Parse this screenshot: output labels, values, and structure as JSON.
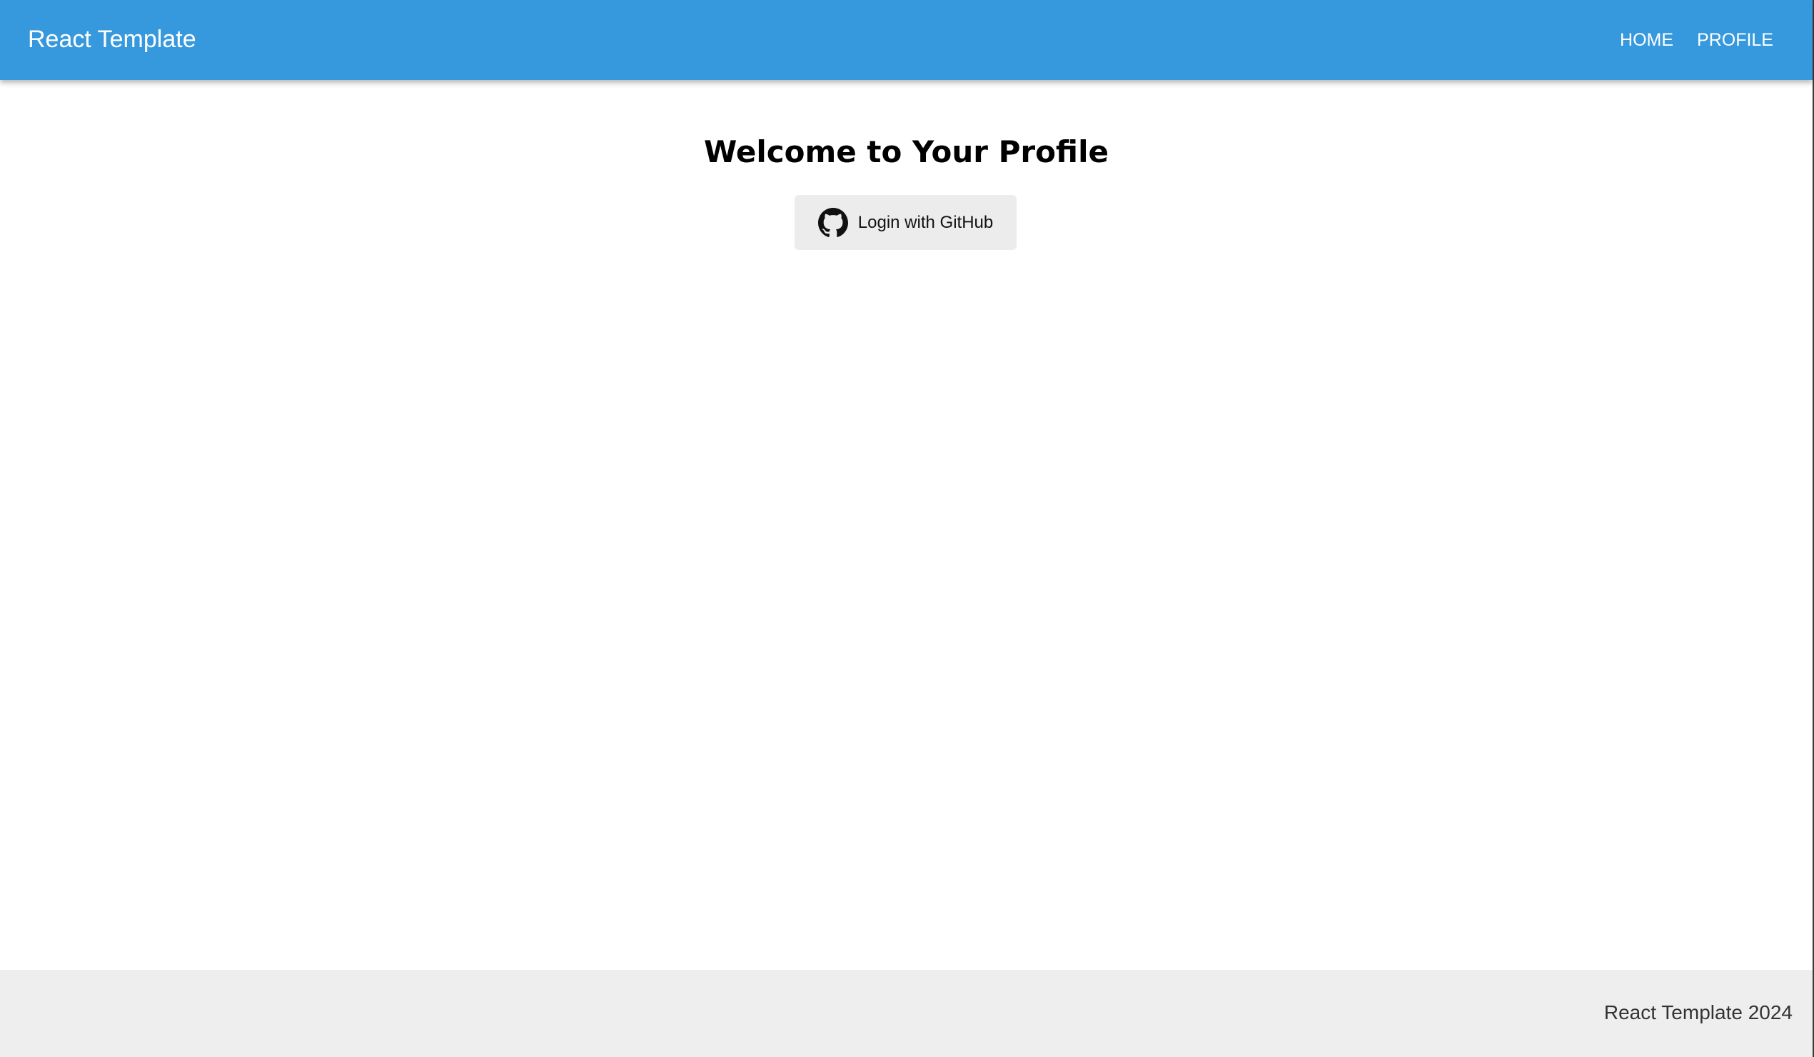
{
  "header": {
    "title": "React Template",
    "nav": [
      {
        "label": "HOME"
      },
      {
        "label": "PROFILE"
      }
    ]
  },
  "main": {
    "title": "Welcome to Your Profile",
    "login_button": {
      "label": "Login with GitHub",
      "icon": "github-icon"
    }
  },
  "footer": {
    "text": "React Template 2024"
  },
  "colors": {
    "app_bar": "#3799dd",
    "button_background": "#ececec",
    "footer_background": "#eeeeee"
  }
}
